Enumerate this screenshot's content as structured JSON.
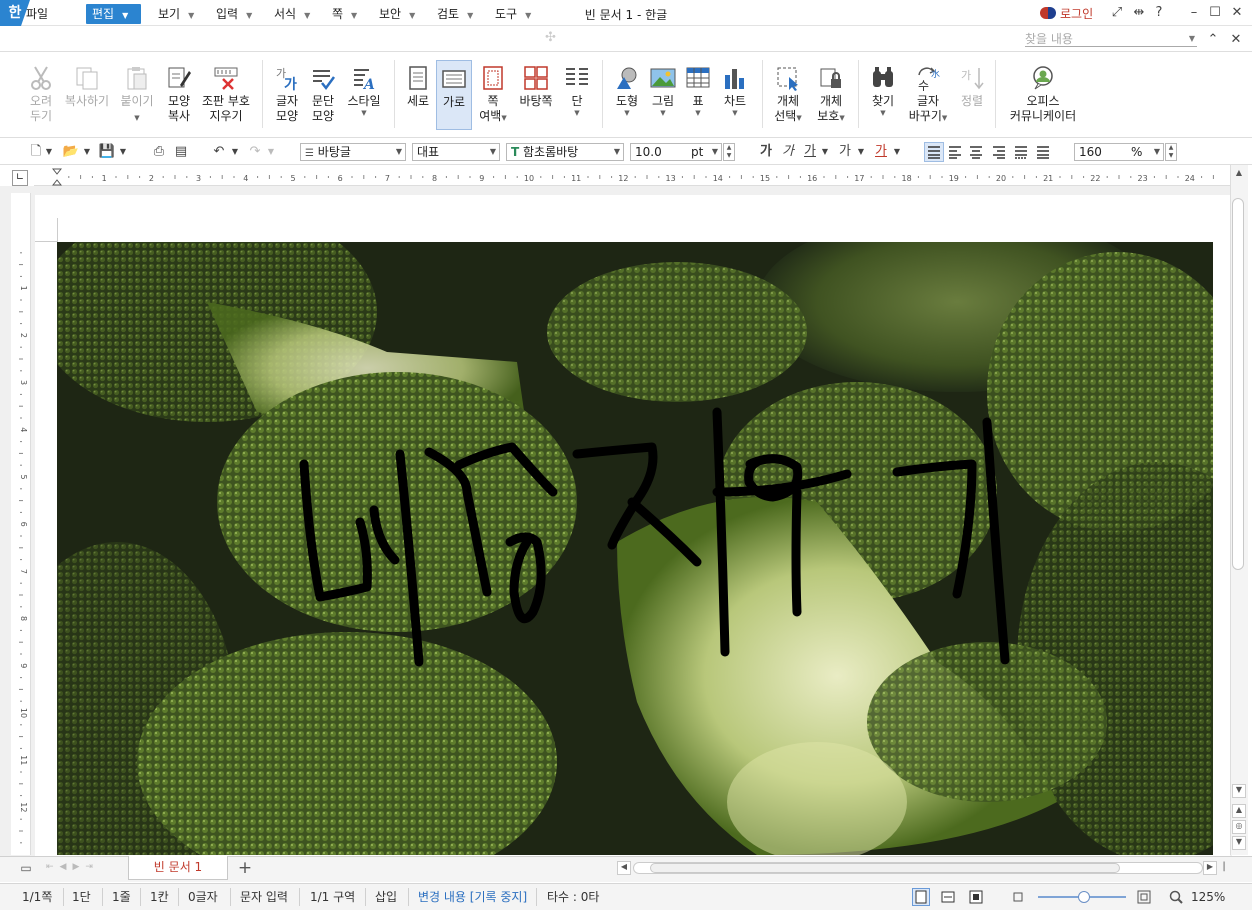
{
  "window": {
    "app_icon": "한",
    "title": "빈 문서 1 - 한글",
    "login": "로그인",
    "help": "?"
  },
  "menu": [
    "파일",
    "편집",
    "보기",
    "입력",
    "서식",
    "쪽",
    "보안",
    "검토",
    "도구"
  ],
  "find_placeholder": "찾을 내용",
  "ribbon": {
    "cut": [
      "오려",
      "두기"
    ],
    "copy": "복사하기",
    "paste": "붙이기",
    "format_copy": [
      "모양",
      "복사"
    ],
    "erase_marks": [
      "조판 부호",
      "지우기"
    ],
    "char_shape": [
      "글자",
      "모양"
    ],
    "para_shape": [
      "문단",
      "모양"
    ],
    "style": "스타일",
    "portrait": "세로",
    "landscape": "가로",
    "margins": [
      "쪽",
      "여백"
    ],
    "bg_page": "바탕쪽",
    "columns": "단",
    "shape": "도형",
    "picture": "그림",
    "table": "표",
    "chart": "차트",
    "obj_select": [
      "개체",
      "선택"
    ],
    "obj_protect": [
      "개체",
      "보호"
    ],
    "find": "찾기",
    "replace": [
      "글자",
      "바꾸기"
    ],
    "align": "정렬",
    "office_comm": [
      "오피스",
      "커뮤니케이터"
    ]
  },
  "format_toolbar": {
    "style": "바탕글",
    "lang": "대표",
    "font": "함초롬바탕",
    "font_size": "10.0",
    "unit": "pt",
    "zoom": "160",
    "zoom_unit": "%"
  },
  "ruler_numbers": [
    "1",
    "2",
    "3",
    "4",
    "5",
    "6",
    "7",
    "8",
    "9",
    "10",
    "11",
    "12",
    "13",
    "14",
    "15",
    "16",
    "17",
    "18",
    "19",
    "20",
    "21",
    "22",
    "23",
    "24"
  ],
  "document": {
    "handwritten_text": "배경지우기"
  },
  "doc_tab": "빈 문서 1",
  "status": {
    "page": "1/1쪽",
    "col": "1단",
    "line": "1줄",
    "pos": "1칸",
    "chars": "0글자",
    "mode": "문자 입력",
    "section": "1/1 구역",
    "insert": "삽입",
    "track": "변경 내용 [기록 중지]",
    "typing": "타수 : 0타",
    "zoom": "125%"
  },
  "colors": {
    "accent": "#2b84d0",
    "login_red": "#c0392b"
  }
}
